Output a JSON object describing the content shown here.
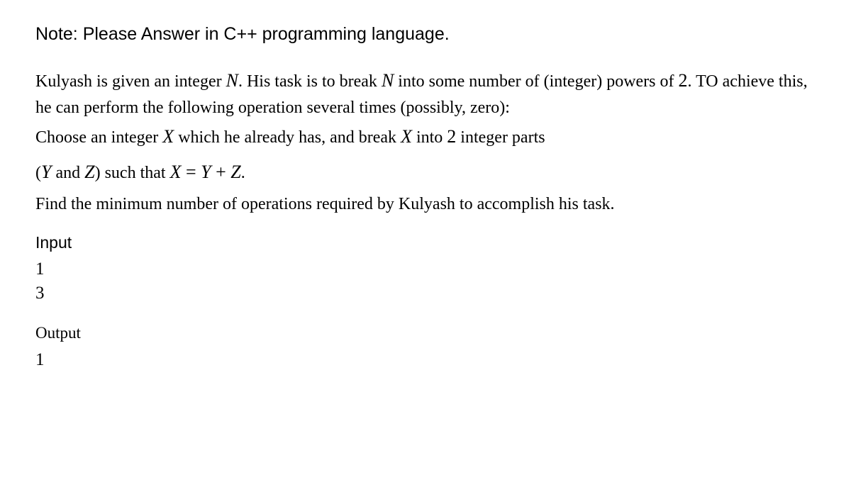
{
  "note": "Note: Please Answer in C++ programming language.",
  "problem": {
    "intro_pre": "Kulyash is given an integer ",
    "var_n": "N",
    "intro_mid": ". His task is to break ",
    "var_n2": "N",
    "intro_post": " into some number of (integer) powers of ",
    "num_2": "2",
    "intro_end": ". TO achieve this, he can perform the following operation several times (possibly, zero):",
    "op_pre": "Choose an integer ",
    "var_x": "X",
    "op_mid": " which he already has, and break ",
    "var_x2": "X",
    "op_mid2": " into ",
    "num_2b": "2",
    "op_mid3": " integer parts",
    "op2_pre": "(",
    "var_y": "Y",
    "op2_and": " and ",
    "var_z": "Z",
    "op2_mid": ") such that ",
    "eq_x": "X",
    "eq_eq": " = ",
    "eq_y": "Y",
    "eq_plus": " + ",
    "eq_z": "Z",
    "op2_end": ".",
    "find": "Find the minimum number of operations required by Kulyash to accomplish his task."
  },
  "io": {
    "input_label": "Input",
    "input_line1": "1",
    "input_line2": "3",
    "output_label": "Output",
    "output_line1": "1"
  }
}
